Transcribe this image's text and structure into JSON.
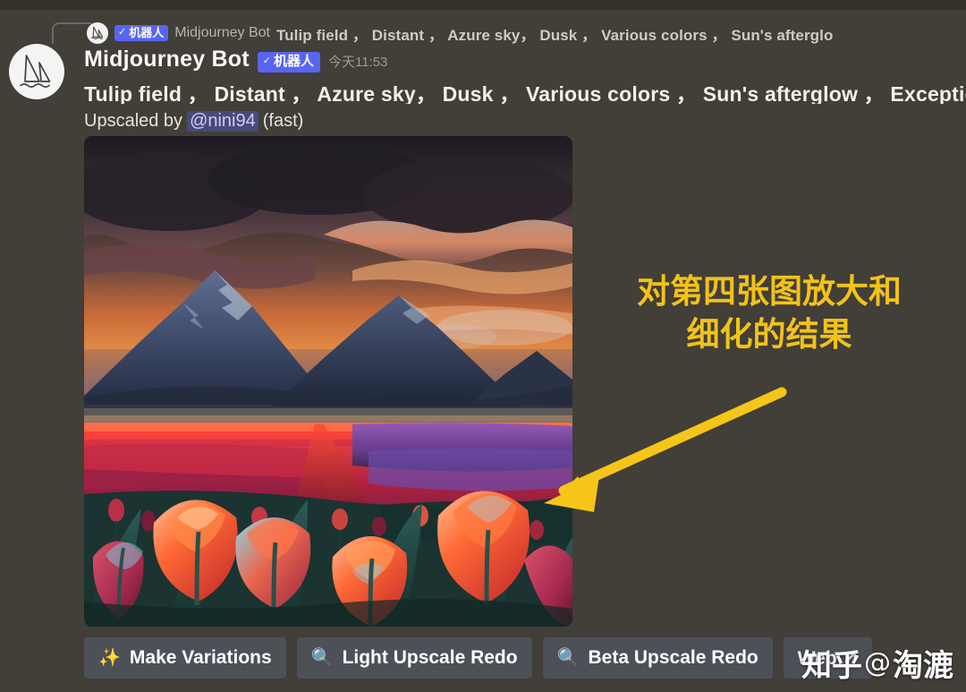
{
  "theme": {
    "background": "#423e38",
    "top_strip": "#34312c",
    "badge_color": "#5865f2",
    "button_bg": "#4e5058",
    "annotation_color": "#f2c317",
    "arrow_color": "#f5c518"
  },
  "reply_preview": {
    "avatar_icon": "midjourney-sailboat-icon",
    "badge_check": "✓",
    "badge_label": "机器人",
    "author": "Midjourney Bot",
    "text": "Tulip field ， Distant ， Azure sky， Dusk ， Various colors ， Sun's afterglo"
  },
  "message": {
    "avatar_icon": "midjourney-sailboat-icon",
    "author": "Midjourney Bot",
    "badge_check": "✓",
    "badge_label": "机器人",
    "timestamp": "今天11:53",
    "prompt": "Tulip field ， Distant ， Azure sky， Dusk ， Various colors ， Sun's afterglow ， Exceptiona",
    "upscaled_prefix": "Upscaled by",
    "upscaled_mention": "@nini94",
    "upscaled_suffix": "(fast)"
  },
  "artwork": {
    "alt": "Tulip field at dusk with mountains and dramatic clouds"
  },
  "annotation": {
    "line1": "对第四张图放大和",
    "line2": "细化的结果"
  },
  "buttons": [
    {
      "icon": "✨",
      "icon_name": "sparkles-icon",
      "label": "Make Variations"
    },
    {
      "icon": "🔍",
      "icon_name": "magnifier-icon",
      "label": "Light Upscale Redo"
    },
    {
      "icon": "🔍",
      "icon_name": "magnifier-icon",
      "label": "Beta Upscale Redo"
    },
    {
      "icon": "",
      "icon_name": "external-link-icon",
      "label": "Web ↗"
    }
  ],
  "watermark": {
    "site": "知乎",
    "at": "@",
    "user": "淘漉"
  }
}
